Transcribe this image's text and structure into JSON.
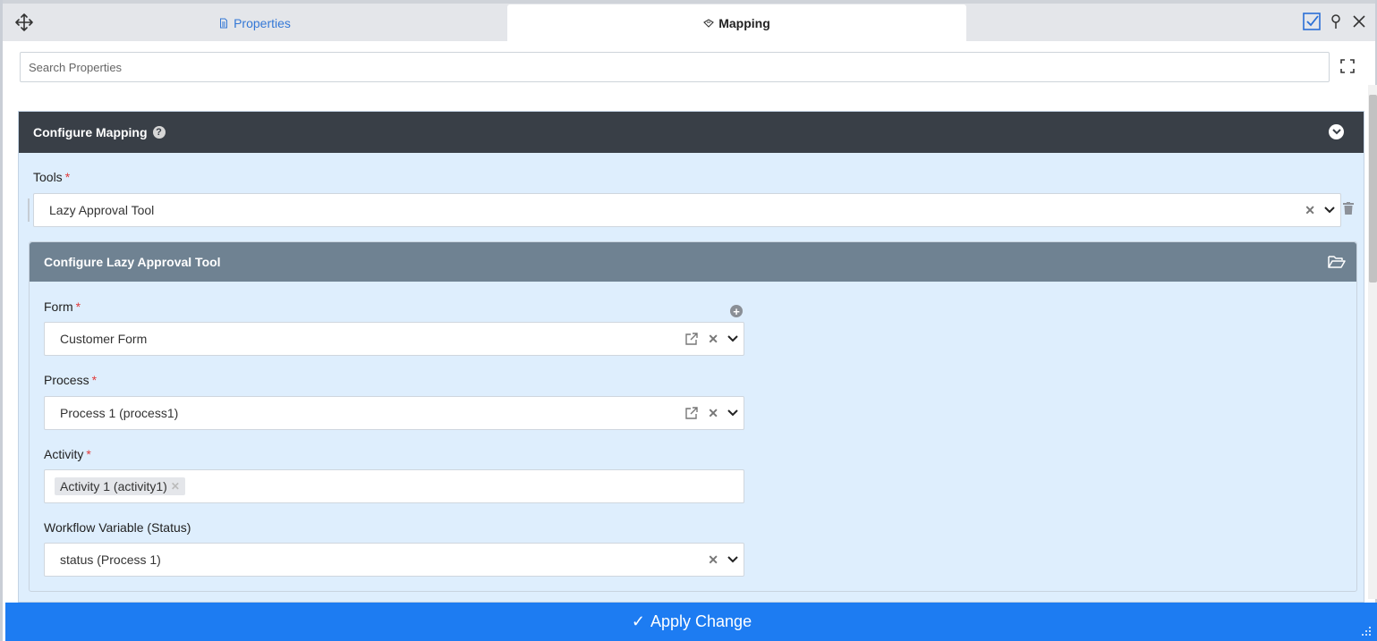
{
  "tabs": {
    "properties_label": "Properties",
    "mapping_label": "Mapping"
  },
  "search": {
    "placeholder": "Search Properties"
  },
  "configure_mapping": {
    "title": "Configure Mapping",
    "help_glyph": "?",
    "tools_label": "Tools",
    "required_mark": "*",
    "tools_value": "Lazy Approval Tool"
  },
  "configure_tool": {
    "title": "Configure Lazy Approval Tool",
    "form_label": "Form",
    "form_value": "Customer Form",
    "process_label": "Process",
    "process_value": "Process 1 (process1)",
    "activity_label": "Activity",
    "activity_tag": "Activity 1 (activity1)",
    "variable_label": "Workflow Variable (Status)",
    "variable_value": "status (Process 1)",
    "plus_glyph": "+",
    "clear_glyph": "✕"
  },
  "footer": {
    "apply_label": "Apply Change",
    "apply_icon": "✓"
  },
  "colors": {
    "accent": "#1d7cf2",
    "panel_header": "#393f47",
    "subpanel_header": "#6f8292",
    "panel_bg": "#deeefd",
    "required": "#e03b3b"
  }
}
